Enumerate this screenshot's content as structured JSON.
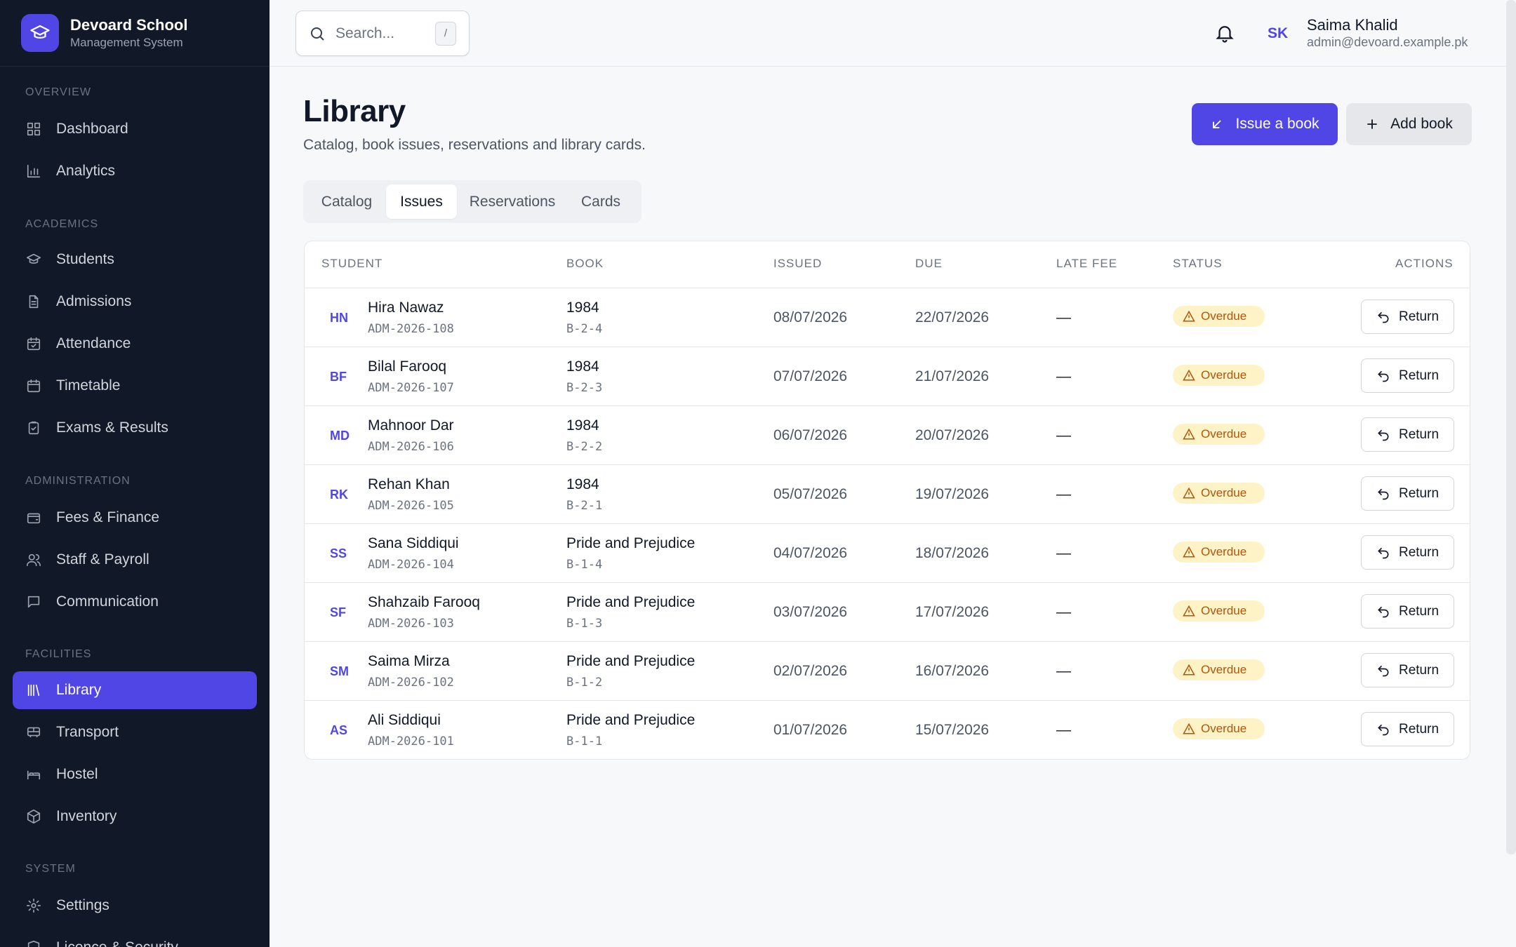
{
  "brand": {
    "name": "Devoard School",
    "subtitle": "Management System",
    "icon": "graduation-cap-icon"
  },
  "sidebar": {
    "sections": [
      {
        "label": "OVERVIEW",
        "items": [
          {
            "label": "Dashboard",
            "icon": "grid-icon"
          },
          {
            "label": "Analytics",
            "icon": "bar-chart-icon"
          }
        ]
      },
      {
        "label": "ACADEMICS",
        "items": [
          {
            "label": "Students",
            "icon": "graduation-cap-icon"
          },
          {
            "label": "Admissions",
            "icon": "document-icon"
          },
          {
            "label": "Attendance",
            "icon": "calendar-check-icon"
          },
          {
            "label": "Timetable",
            "icon": "calendar-icon"
          },
          {
            "label": "Exams & Results",
            "icon": "clipboard-check-icon"
          }
        ]
      },
      {
        "label": "ADMINISTRATION",
        "items": [
          {
            "label": "Fees & Finance",
            "icon": "wallet-icon"
          },
          {
            "label": "Staff & Payroll",
            "icon": "users-icon"
          },
          {
            "label": "Communication",
            "icon": "message-icon"
          }
        ]
      },
      {
        "label": "FACILITIES",
        "items": [
          {
            "label": "Library",
            "icon": "library-icon",
            "active": true
          },
          {
            "label": "Transport",
            "icon": "bus-icon"
          },
          {
            "label": "Hostel",
            "icon": "bed-icon"
          },
          {
            "label": "Inventory",
            "icon": "package-icon"
          }
        ]
      },
      {
        "label": "SYSTEM",
        "items": [
          {
            "label": "Settings",
            "icon": "gear-icon"
          },
          {
            "label": "Licence & Security",
            "icon": "shield-icon"
          }
        ]
      }
    ]
  },
  "topbar": {
    "search_placeholder": "Search...",
    "search_shortcut": "/",
    "user": {
      "initials": "SK",
      "name": "Saima Khalid",
      "email": "admin@devoard.example.pk"
    }
  },
  "page": {
    "title": "Library",
    "subtitle": "Catalog, book issues, reservations and library cards.",
    "primary_action": "Issue a book",
    "secondary_action": "Add book"
  },
  "tabs": [
    {
      "label": "Catalog",
      "active": false
    },
    {
      "label": "Issues",
      "active": true
    },
    {
      "label": "Reservations",
      "active": false
    },
    {
      "label": "Cards",
      "active": false
    }
  ],
  "table": {
    "headers": {
      "student": "STUDENT",
      "book": "BOOK",
      "issued": "ISSUED",
      "due": "DUE",
      "late_fee": "LATE FEE",
      "status": "STATUS",
      "actions": "ACTIONS"
    },
    "action_label": "Return",
    "rows": [
      {
        "initials": "HN",
        "name": "Hira Nawaz",
        "admission": "ADM-2026-108",
        "book": "1984",
        "shelf": "B-2-4",
        "issued": "08/07/2026",
        "due": "22/07/2026",
        "late_fee": "—",
        "status": "Overdue"
      },
      {
        "initials": "BF",
        "name": "Bilal Farooq",
        "admission": "ADM-2026-107",
        "book": "1984",
        "shelf": "B-2-3",
        "issued": "07/07/2026",
        "due": "21/07/2026",
        "late_fee": "—",
        "status": "Overdue"
      },
      {
        "initials": "MD",
        "name": "Mahnoor Dar",
        "admission": "ADM-2026-106",
        "book": "1984",
        "shelf": "B-2-2",
        "issued": "06/07/2026",
        "due": "20/07/2026",
        "late_fee": "—",
        "status": "Overdue"
      },
      {
        "initials": "RK",
        "name": "Rehan Khan",
        "admission": "ADM-2026-105",
        "book": "1984",
        "shelf": "B-2-1",
        "issued": "05/07/2026",
        "due": "19/07/2026",
        "late_fee": "—",
        "status": "Overdue"
      },
      {
        "initials": "SS",
        "name": "Sana Siddiqui",
        "admission": "ADM-2026-104",
        "book": "Pride and Prejudice",
        "shelf": "B-1-4",
        "issued": "04/07/2026",
        "due": "18/07/2026",
        "late_fee": "—",
        "status": "Overdue"
      },
      {
        "initials": "SF",
        "name": "Shahzaib Farooq",
        "admission": "ADM-2026-103",
        "book": "Pride and Prejudice",
        "shelf": "B-1-3",
        "issued": "03/07/2026",
        "due": "17/07/2026",
        "late_fee": "—",
        "status": "Overdue"
      },
      {
        "initials": "SM",
        "name": "Saima Mirza",
        "admission": "ADM-2026-102",
        "book": "Pride and Prejudice",
        "shelf": "B-1-2",
        "issued": "02/07/2026",
        "due": "16/07/2026",
        "late_fee": "—",
        "status": "Overdue"
      },
      {
        "initials": "AS",
        "name": "Ali Siddiqui",
        "admission": "ADM-2026-101",
        "book": "Pride and Prejudice",
        "shelf": "B-1-1",
        "issued": "01/07/2026",
        "due": "15/07/2026",
        "late_fee": "—",
        "status": "Overdue"
      }
    ]
  },
  "colors": {
    "accent": "#4f46e5",
    "sidebar_bg": "#111827",
    "warning_bg": "#fef3c7",
    "warning_text": "#b45309"
  }
}
